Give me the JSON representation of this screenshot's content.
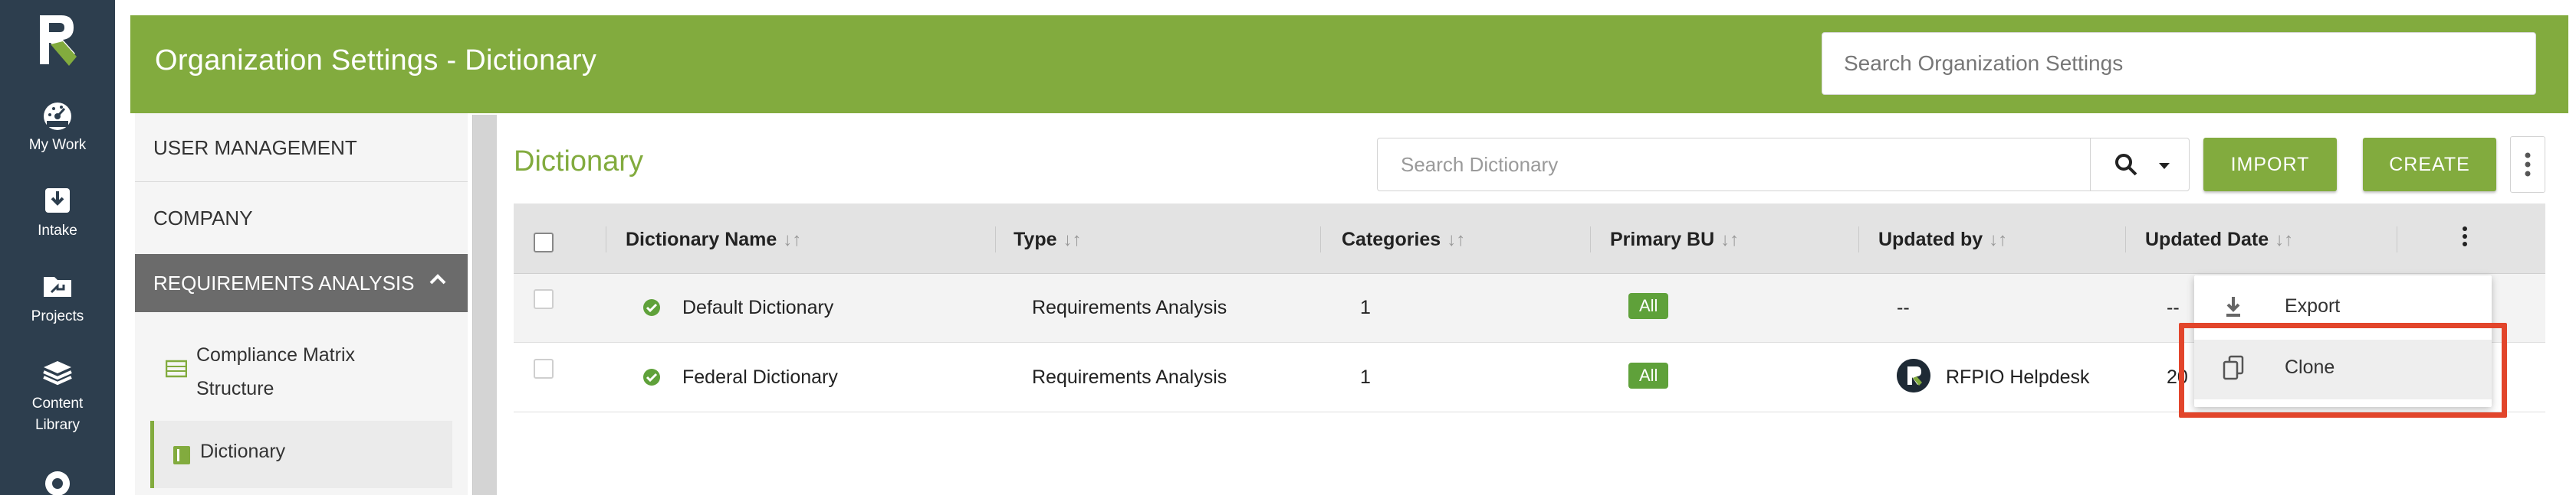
{
  "colors": {
    "brand_green": "#82ab3e",
    "rail_bg": "#2d3e4e",
    "active_nav_bg": "#6b6b6b",
    "badge_green": "#5fa13a",
    "highlight_red": "#e2452b"
  },
  "rail": {
    "logo_icon": "rfpio-r-logo-icon",
    "items": [
      {
        "label": "My Work",
        "icon": "speedometer-icon"
      },
      {
        "label": "Intake",
        "icon": "intake-icon"
      },
      {
        "label": "Projects",
        "icon": "projects-folder-icon"
      },
      {
        "label": "Content\nLibrary",
        "label_line1": "Content",
        "label_line2": "Library",
        "icon": "stack-books-icon"
      }
    ]
  },
  "header": {
    "title": "Organization Settings - Dictionary",
    "search_placeholder": "Search Organization Settings"
  },
  "settings_nav": {
    "items": [
      {
        "label": "USER MANAGEMENT"
      },
      {
        "label": "COMPANY"
      },
      {
        "label": "REQUIREMENTS ANALYSIS"
      }
    ],
    "sub_items": [
      {
        "label_line1": "Compliance Matrix",
        "label_line2": "Structure",
        "icon": "matrix-table-icon"
      },
      {
        "label": "Dictionary",
        "icon": "dictionary-book-icon"
      }
    ]
  },
  "main": {
    "title": "Dictionary",
    "search_placeholder": "Search Dictionary",
    "import_label": "IMPORT",
    "create_label": "CREATE"
  },
  "table": {
    "columns": [
      "Dictionary Name",
      "Type",
      "Categories",
      "Primary BU",
      "Updated by",
      "Updated Date"
    ],
    "sort_glyph": "↓↑",
    "rows": [
      {
        "name": "Default Dictionary",
        "type": "Requirements Analysis",
        "categories": "1",
        "primary_bu": "All",
        "updated_by": "--",
        "updated_date": "--"
      },
      {
        "name": "Federal Dictionary",
        "type": "Requirements Analysis",
        "categories": "1",
        "primary_bu": "All",
        "updated_by": "RFPIO Helpdesk",
        "updated_date": "20"
      }
    ]
  },
  "row_menu": {
    "items": [
      {
        "label": "Export",
        "icon": "download-icon"
      },
      {
        "label": "Clone",
        "icon": "copy-icon"
      }
    ]
  }
}
